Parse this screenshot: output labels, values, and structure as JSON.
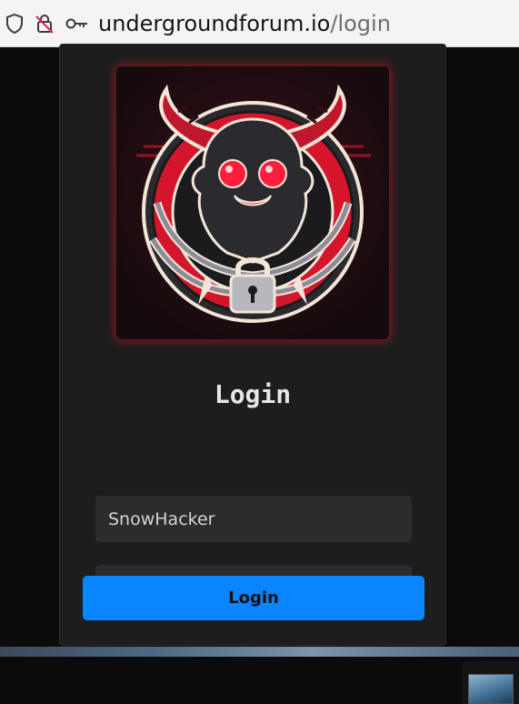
{
  "browser": {
    "url_domain": "undergroundforum.io",
    "url_path": "/login",
    "icons": [
      "shield-icon",
      "insecure-lock-icon",
      "key-icon"
    ]
  },
  "login_card": {
    "logo_alt": "horned creature in chains with padlock",
    "title": "Login",
    "username_value": "SnowHacker",
    "password_value": "●●●●●●●●●",
    "button_label": "Login"
  },
  "colors": {
    "page_bg": "#0b0b0b",
    "card_bg": "#1d1d1d",
    "input_bg": "#2c2c2c",
    "button_bg": "#0a84ff",
    "logo_accent": "#d4152b"
  }
}
